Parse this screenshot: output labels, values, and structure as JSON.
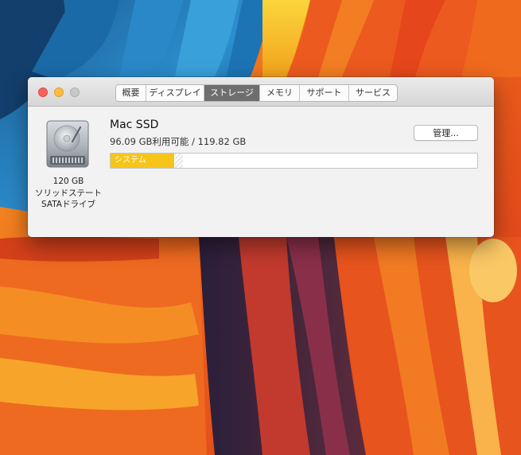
{
  "window": {
    "tabs": [
      {
        "label": "概要",
        "active": false
      },
      {
        "label": "ディスプレイ",
        "active": false
      },
      {
        "label": "ストレージ",
        "active": true
      },
      {
        "label": "メモリ",
        "active": false
      },
      {
        "label": "サポート",
        "active": false
      },
      {
        "label": "サービス",
        "active": false
      }
    ]
  },
  "disk": {
    "icon": "hard-drive-icon",
    "capacity_label": "120 GB",
    "type_label": "ソリッドステート",
    "interface_label": "SATAドライブ",
    "name": "Mac SSD",
    "available_text": "96.09 GB利用可能 / 119.82 GB",
    "manage_button": "管理...",
    "usage": {
      "total_gb": 119.82,
      "available_gb": 96.09,
      "segments": [
        {
          "label": "システム",
          "fraction": 0.174,
          "color": "#f6c51a"
        },
        {
          "label": "",
          "fraction": 0.024,
          "pattern": "hatched"
        }
      ]
    }
  },
  "colors": {
    "accent_active_tab": "#6e6e6e",
    "system_segment": "#f6c51a",
    "close_button": "#fc605c",
    "minimize_button": "#fdbc40"
  }
}
